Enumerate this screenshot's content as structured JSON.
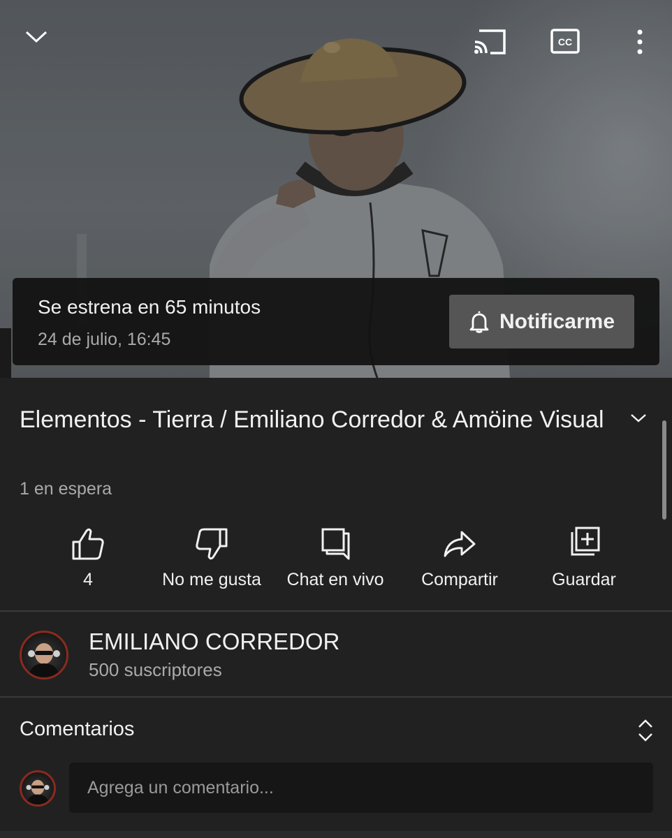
{
  "player": {
    "premiere_title": "Se estrena en 65 minutos",
    "premiere_date": "24 de julio, 16:45",
    "notify_label": "Notificarme",
    "icons": [
      "chevron-down-icon",
      "cast-icon",
      "closed-captions-icon",
      "more-vert-icon",
      "bell-icon"
    ]
  },
  "video": {
    "title": "Elementos - Tierra / Emiliano Corredor & Amöine Visual",
    "waiting": "1 en espera"
  },
  "actions": [
    {
      "label": "4",
      "icon": "thumbs-up-icon"
    },
    {
      "label": "No me gusta",
      "icon": "thumbs-down-icon"
    },
    {
      "label": "Chat en vivo",
      "icon": "live-chat-icon"
    },
    {
      "label": "Compartir",
      "icon": "share-icon"
    },
    {
      "label": "Guardar",
      "icon": "save-playlist-icon"
    }
  ],
  "channel": {
    "name": "EMILIANO CORREDOR",
    "subscribers": "500 suscriptores"
  },
  "comments": {
    "heading": "Comentarios",
    "placeholder": "Agrega un comentario..."
  },
  "colors": {
    "background": "#212121",
    "premiere_bar": "#121212",
    "notify_button": "#555555",
    "secondary_text": "#aaaaaa",
    "avatar_ring": "#8a2a1e"
  }
}
